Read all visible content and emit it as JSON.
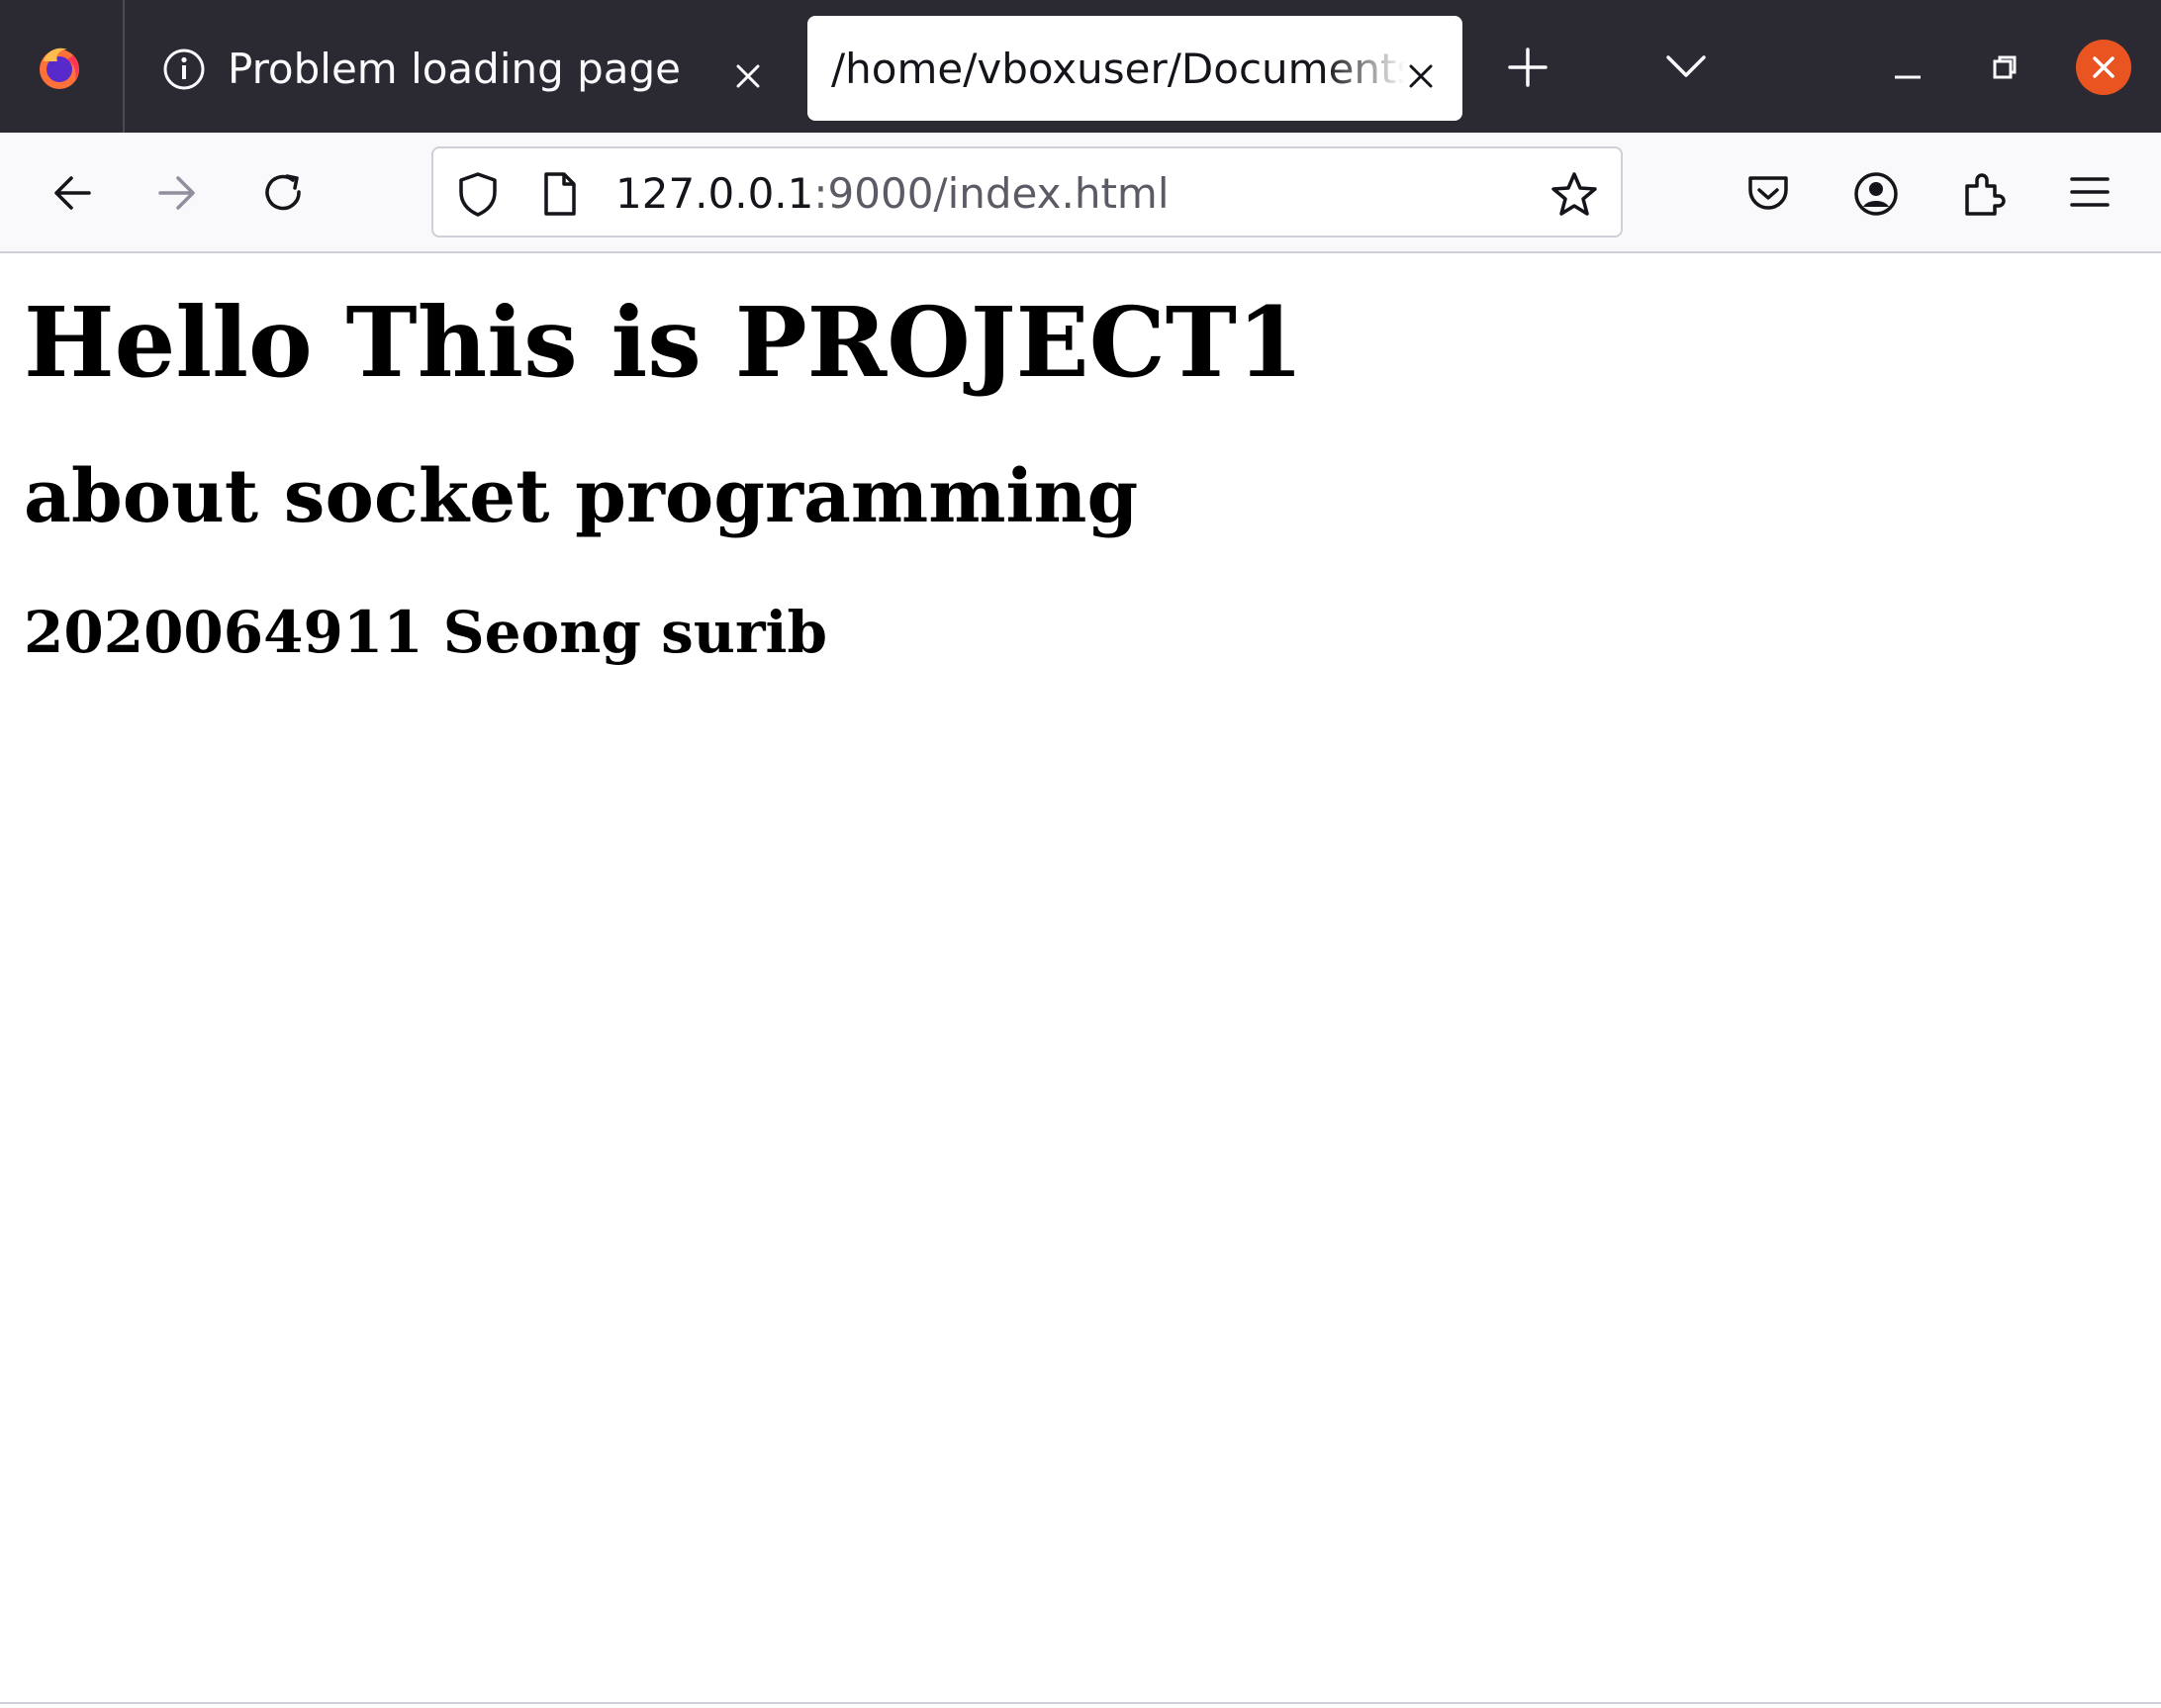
{
  "browser": {
    "tabs": [
      {
        "title": "Problem loading page",
        "active": false,
        "icon": "info-icon"
      },
      {
        "title": "/home/vboxuser/Documents/index.html",
        "active": true,
        "icon": null
      }
    ],
    "window_controls": [
      "minimize-icon",
      "restore-icon",
      "close-icon"
    ],
    "accent_close_color": "#e95420"
  },
  "navbar": {
    "url_host": "127.0.0.1",
    "url_rest": ":9000/index.html",
    "left_icons": [
      "back-arrow-icon",
      "forward-arrow-icon",
      "reload-icon"
    ],
    "right_icons": [
      "pocket-icon",
      "account-icon",
      "extensions-icon",
      "menu-icon"
    ]
  },
  "page": {
    "h1": "Hello This is PROJECT1",
    "h2": "about socket programming",
    "h3": "2020064911 Seong surib"
  }
}
